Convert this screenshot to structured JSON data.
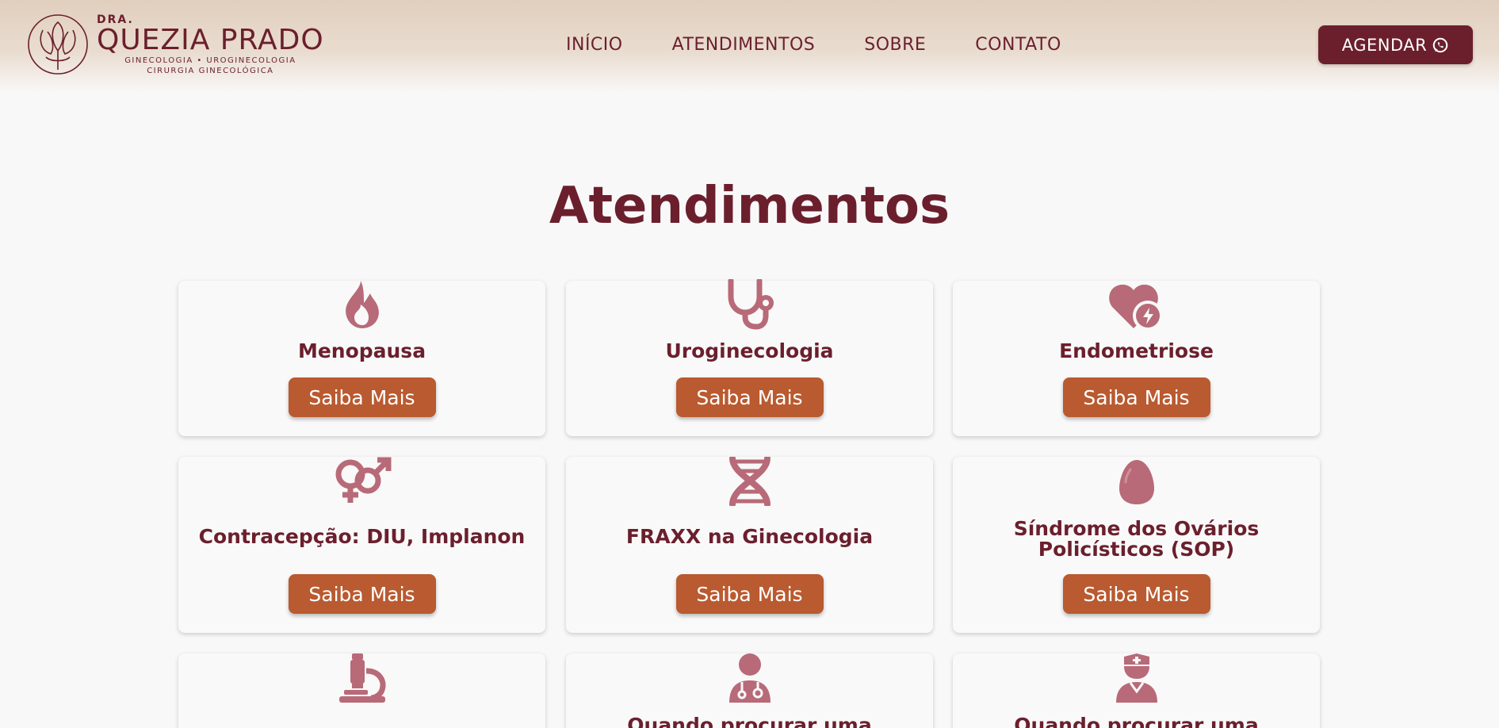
{
  "header": {
    "logo": {
      "prefix": "DRA.",
      "name": "QUEZIA PRADO",
      "subtitle_line1": "GINECOLOGIA • UROGINECOLOGIA",
      "subtitle_line2": "CIRURGIA GINECOLÓGICA"
    },
    "nav": [
      "INÍCIO",
      "ATENDIMENTOS",
      "SOBRE",
      "CONTATO"
    ],
    "cta_label": "AGENDAR",
    "cta_icon": "whatsapp-icon"
  },
  "main": {
    "title": "Atendimentos",
    "cards": [
      {
        "title": "Menopausa",
        "icon": "fire-icon",
        "button": "Saiba Mais"
      },
      {
        "title": "Uroginecologia",
        "icon": "stethoscope-icon",
        "button": "Saiba Mais"
      },
      {
        "title": "Endometriose",
        "icon": "heart-bolt-icon",
        "button": "Saiba Mais"
      },
      {
        "title": "Contracepção: DIU, Implanon",
        "icon": "gender-icon",
        "button": "Saiba Mais"
      },
      {
        "title": "FRAXX na Ginecologia",
        "icon": "dna-icon",
        "button": "Saiba Mais"
      },
      {
        "title": "Síndrome dos Ovários Policísticos (SOP)",
        "icon": "egg-icon",
        "button": "Saiba Mais"
      },
      {
        "title": "",
        "icon": "microscope-icon"
      },
      {
        "title": "Quando procurar uma",
        "icon": "user-doctor-icon"
      },
      {
        "title": "Quando procurar uma",
        "icon": "user-nurse-icon"
      }
    ]
  },
  "colors": {
    "brand": "#6b1f2d",
    "button": "#b95a30",
    "icon": "#b86a78",
    "header_bg": "#e1cfbe"
  }
}
